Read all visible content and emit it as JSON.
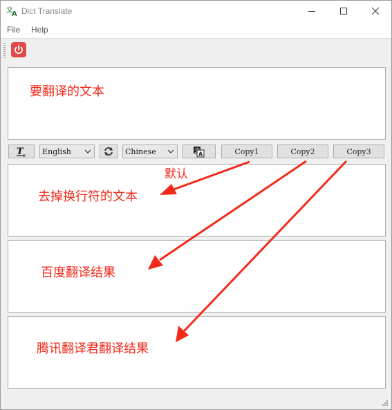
{
  "window": {
    "title": "Dict Translate",
    "app_icon": "translate-icon"
  },
  "menubar": {
    "items": [
      "File",
      "Help"
    ]
  },
  "toolbar": {
    "power_icon": "power-icon",
    "power_color": "#e04a4a"
  },
  "panels": {
    "source": {
      "text": "要翻译的文本"
    },
    "no_newline": {
      "text": "去掉换行符的文本"
    },
    "baidu": {
      "text": "百度翻译结果"
    },
    "tencent": {
      "text": "腾讯翻译君翻译结果"
    }
  },
  "controls": {
    "clear_format_icon": "clear-formatting-icon",
    "source_lang": "English",
    "swap_icon": "swap-languages-icon",
    "target_lang": "Chinese",
    "translate_icon": "translate-icon",
    "copy1": "Copy1",
    "copy2": "Copy2",
    "copy3": "Copy3"
  },
  "annotation": {
    "default_label": "默认",
    "color": "#f22a1a"
  }
}
